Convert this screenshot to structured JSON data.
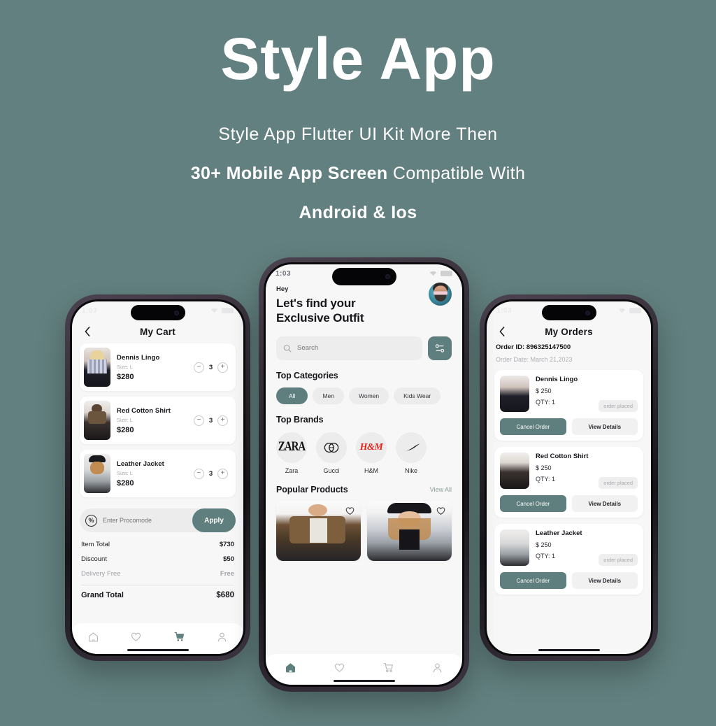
{
  "hero": {
    "title": "Style App",
    "sub1": "Style App Flutter UI Kit More Then",
    "sub2_bold": "30+ Mobile App Screen",
    "sub2_rest": " Compatible With",
    "sub3": "Android & Ios"
  },
  "colors": {
    "background": "#62807f",
    "accent": "#5f7e7e",
    "screen_bg": "#f7f7f7",
    "card": "#ffffff",
    "muted_text": "#a8a8ad",
    "brand_hm": "#e2231a"
  },
  "status_bar": {
    "time": "1:03",
    "wifi_icon": "wifi-icon",
    "battery_icon": "battery-icon"
  },
  "cart_screen": {
    "title": "My Cart",
    "back_icon": "chevron-left-icon",
    "items": [
      {
        "name": "Dennis Lingo",
        "size": "Size: L",
        "price": "$280",
        "qty": "3"
      },
      {
        "name": "Red Cotton Shirt",
        "size": "Size: L",
        "price": "$280",
        "qty": "3"
      },
      {
        "name": "Leather Jacket",
        "size": "Size: L",
        "price": "$280",
        "qty": "3"
      }
    ],
    "promo": {
      "placeholder": "Enter Procomode",
      "value": "",
      "icon": "percent-badge-icon",
      "apply_label": "Apply"
    },
    "totals": [
      {
        "label": "Item Total",
        "value": "$730",
        "muted": false
      },
      {
        "label": "Discount",
        "value": "$50",
        "muted": false
      },
      {
        "label": "Delivery Free",
        "value": "Free",
        "muted": true
      }
    ],
    "grand": {
      "label": "Grand Total",
      "value": "$680"
    },
    "nav": [
      {
        "name": "home-icon",
        "active": false
      },
      {
        "name": "heart-icon",
        "active": false
      },
      {
        "name": "cart-icon",
        "active": true
      },
      {
        "name": "profile-icon",
        "active": false
      }
    ]
  },
  "home_screen": {
    "greeting": "Hey",
    "headline_line1": "Let's find your",
    "headline_line2": "Exclusive Outfit",
    "avatar_icon": "user-avatar",
    "search": {
      "placeholder": "Search",
      "value": "",
      "icon": "search-icon"
    },
    "filter_icon": "filter-sliders-icon",
    "categories_title": "Top Categories",
    "categories": [
      {
        "label": "All",
        "active": true
      },
      {
        "label": "Men",
        "active": false
      },
      {
        "label": "Women",
        "active": false
      },
      {
        "label": "Kids Wear",
        "active": false
      }
    ],
    "brands_title": "Top Brands",
    "brands": [
      {
        "label": "Zara",
        "logo": "ZARA"
      },
      {
        "label": "Gucci",
        "logo": "gucci-gg-icon"
      },
      {
        "label": "H&M",
        "logo": "H&M"
      },
      {
        "label": "Nike",
        "logo": "nike-swoosh-icon"
      }
    ],
    "popular_title": "Popular Products",
    "view_all": "View All",
    "products": [
      {
        "name": "male-model-card",
        "favorite_icon": "heart-outline-icon"
      },
      {
        "name": "female-model-card",
        "favorite_icon": "heart-outline-icon"
      }
    ],
    "nav": [
      {
        "name": "home-icon",
        "active": true
      },
      {
        "name": "heart-icon",
        "active": false
      },
      {
        "name": "cart-icon",
        "active": false
      },
      {
        "name": "profile-icon",
        "active": false
      }
    ]
  },
  "orders_screen": {
    "title": "My Orders",
    "back_icon": "chevron-left-icon",
    "order_id": "Order ID: 896325147500",
    "order_date": "Order Date: March 21,2023",
    "orders": [
      {
        "name": "Dennis Lingo",
        "price": "$ 250",
        "qty": "QTY: 1",
        "status": "order placed",
        "cancel_label": "Cancel Order",
        "view_label": "View Details"
      },
      {
        "name": "Red Cotton Shirt",
        "price": "$ 250",
        "qty": "QTY: 1",
        "status": "order placed",
        "cancel_label": "Cancel Order",
        "view_label": "View Details"
      },
      {
        "name": "Leather Jacket",
        "price": "$ 250",
        "qty": "QTY: 1",
        "status": "order placed",
        "cancel_label": "Cancel Order",
        "view_label": "View Details"
      }
    ]
  }
}
